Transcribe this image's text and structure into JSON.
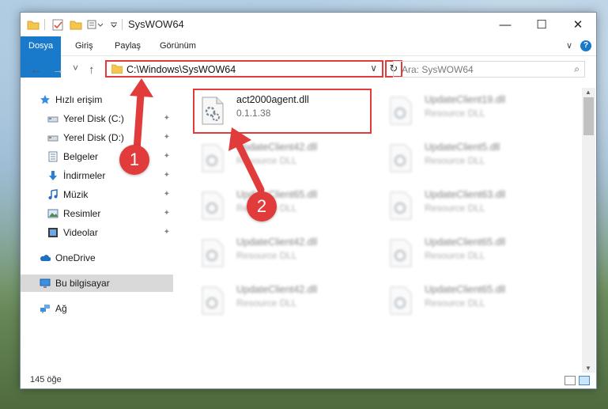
{
  "window": {
    "title": "SysWOW64",
    "minimize": "—",
    "maximize": "☐",
    "close": "✕"
  },
  "ribbon": {
    "tabs": [
      "Dosya",
      "Giriş",
      "Paylaş",
      "Görünüm"
    ],
    "help": "?",
    "expand": "∨"
  },
  "nav": {
    "back": "←",
    "forward": "→",
    "recent": "˅",
    "up": "↑",
    "address": "C:\\Windows\\SysWOW64",
    "address_drop": "∨",
    "refresh": "↻",
    "search_placeholder": "Ara: SysWOW64",
    "search_icon": "⌕"
  },
  "sidebar": {
    "items": [
      {
        "label": "Hızlı erişim",
        "icon": "star-icon",
        "pinned": false
      },
      {
        "label": "Yerel Disk (C:)",
        "icon": "drive-icon",
        "pinned": true
      },
      {
        "label": "Yerel Disk (D:)",
        "icon": "drive-icon",
        "pinned": true
      },
      {
        "label": "Belgeler",
        "icon": "documents-icon",
        "pinned": true
      },
      {
        "label": "İndirmeler",
        "icon": "download-icon",
        "pinned": true
      },
      {
        "label": "Müzik",
        "icon": "music-icon",
        "pinned": true
      },
      {
        "label": "Resimler",
        "icon": "pictures-icon",
        "pinned": true
      },
      {
        "label": "Videolar",
        "icon": "videos-icon",
        "pinned": true
      },
      {
        "label": "OneDrive",
        "icon": "onedrive-icon",
        "pinned": false
      },
      {
        "label": "Bu bilgisayar",
        "icon": "computer-icon",
        "pinned": false
      },
      {
        "label": "Ağ",
        "icon": "network-icon",
        "pinned": false
      }
    ],
    "pin_glyph": "📌"
  },
  "files": [
    {
      "name": "act2000agent.dll",
      "sub": "0.1.1.38",
      "blurred": false
    },
    {
      "name": "UpdateClient19.dll",
      "sub": "Resource DLL",
      "blurred": true
    },
    {
      "name": "UpdateClient42.dll",
      "sub": "Resource DLL",
      "blurred": true
    },
    {
      "name": "UpdateClient5.dll",
      "sub": "Resource DLL",
      "blurred": true
    },
    {
      "name": "UpdateClient65.dll",
      "sub": "Resource DLL",
      "blurred": true
    },
    {
      "name": "UpdateClient63.dll",
      "sub": "Resource DLL",
      "blurred": true
    },
    {
      "name": "UpdateClient42.dll",
      "sub": "Resource DLL",
      "blurred": true
    },
    {
      "name": "UpdateClient65.dll",
      "sub": "Resource DLL",
      "blurred": true
    },
    {
      "name": "UpdateClient42.dll",
      "sub": "Resource DLL",
      "blurred": true
    },
    {
      "name": "UpdateClient65.dll",
      "sub": "Resource DLL",
      "blurred": true
    }
  ],
  "status": {
    "count": "145 öğe"
  },
  "annotations": {
    "badge1": "1",
    "badge2": "2",
    "color": "#e23b3b"
  }
}
